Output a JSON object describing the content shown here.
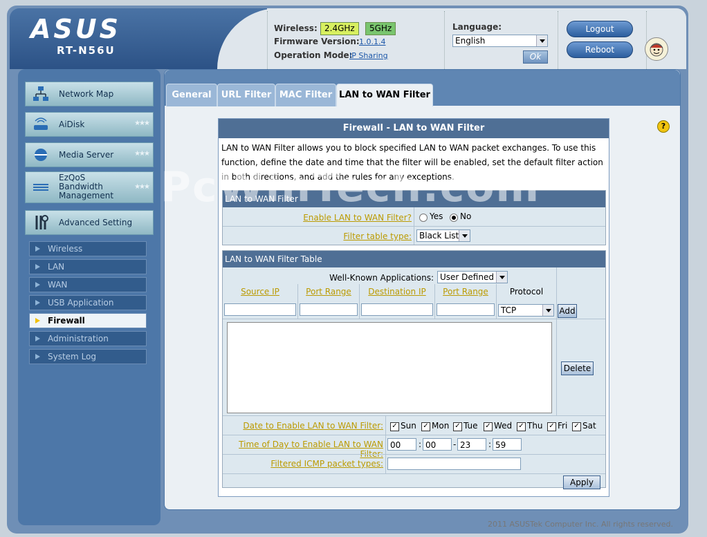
{
  "header": {
    "brand": "ASUS",
    "model": "RT-N56U",
    "wireless_label": "Wireless:",
    "band_24": "2.4GHz",
    "band_5": "5GHz",
    "firmware_label": "Firmware Version:",
    "firmware_value": "1.0.1.4",
    "opmode_label": "Operation Mode:",
    "opmode_value": "IP Sharing",
    "language_label": "Language:",
    "language_value": "English",
    "ok_label": "Ok",
    "logout_label": "Logout",
    "reboot_label": "Reboot"
  },
  "sidebar": {
    "main_items": [
      {
        "label": "Network Map",
        "icon": "network-map-icon"
      },
      {
        "label": "AiDisk",
        "icon": "aidisk-icon"
      },
      {
        "label": "Media Server",
        "icon": "media-server-icon"
      },
      {
        "label": "EzQoS Bandwidth Management",
        "icon": "qos-icon"
      },
      {
        "label": "Advanced Setting",
        "icon": "tools-icon"
      }
    ],
    "sub_items": [
      {
        "label": "Wireless"
      },
      {
        "label": "LAN"
      },
      {
        "label": "WAN"
      },
      {
        "label": "USB Application"
      },
      {
        "label": "Firewall"
      },
      {
        "label": "Administration"
      },
      {
        "label": "System Log"
      }
    ],
    "active_sub": "Firewall"
  },
  "tabs": [
    {
      "label": "General"
    },
    {
      "label": "URL Filter"
    },
    {
      "label": "MAC Filter"
    },
    {
      "label": "LAN to WAN Filter"
    }
  ],
  "active_tab": "LAN to WAN Filter",
  "panel": {
    "title": "Firewall - LAN to WAN Filter",
    "description": "LAN to WAN Filter allows you to block specified LAN to WAN packet exchanges. To use this function, define the date and time that the filter will be enabled, set the default filter action in both directions, and add the rules for any exceptions.",
    "section1_title": "LAN to WAN Filter",
    "enable_label": "Enable LAN to WAN Filter?",
    "yes_label": "Yes",
    "no_label": "No",
    "enable_value": "No",
    "filter_type_label": "Filter table type:",
    "filter_type_value": "Black List",
    "section2_title": "LAN to WAN Filter Table",
    "wellknown_label": "Well-Known Applications:",
    "wellknown_value": "User Defined",
    "columns": [
      "Source IP",
      "Port Range",
      "Destination IP",
      "Port Range",
      "Protocol"
    ],
    "protocol_value": "TCP",
    "add_label": "Add",
    "delete_label": "Delete",
    "date_label": "Date to Enable LAN to WAN Filter:",
    "days": [
      {
        "label": "Sun",
        "checked": true
      },
      {
        "label": "Mon",
        "checked": true
      },
      {
        "label": "Tue",
        "checked": true
      },
      {
        "label": "Wed",
        "checked": true
      },
      {
        "label": "Thu",
        "checked": true
      },
      {
        "label": "Fri",
        "checked": true
      },
      {
        "label": "Sat",
        "checked": true
      }
    ],
    "time_label": "Time of Day to Enable LAN to WAN Filter:",
    "time_start_hour": "00",
    "time_start_min": "00",
    "time_end_hour": "23",
    "time_end_min": "59",
    "icmp_label": "Filtered ICMP packet types:",
    "icmp_value": "",
    "apply_label": "Apply"
  },
  "watermark": "PcWinTech.com",
  "footer": "2011 ASUSTek Computer Inc. All rights reserved.",
  "colors": {
    "accent": "#4f6f95",
    "link": "#bb9a00"
  }
}
